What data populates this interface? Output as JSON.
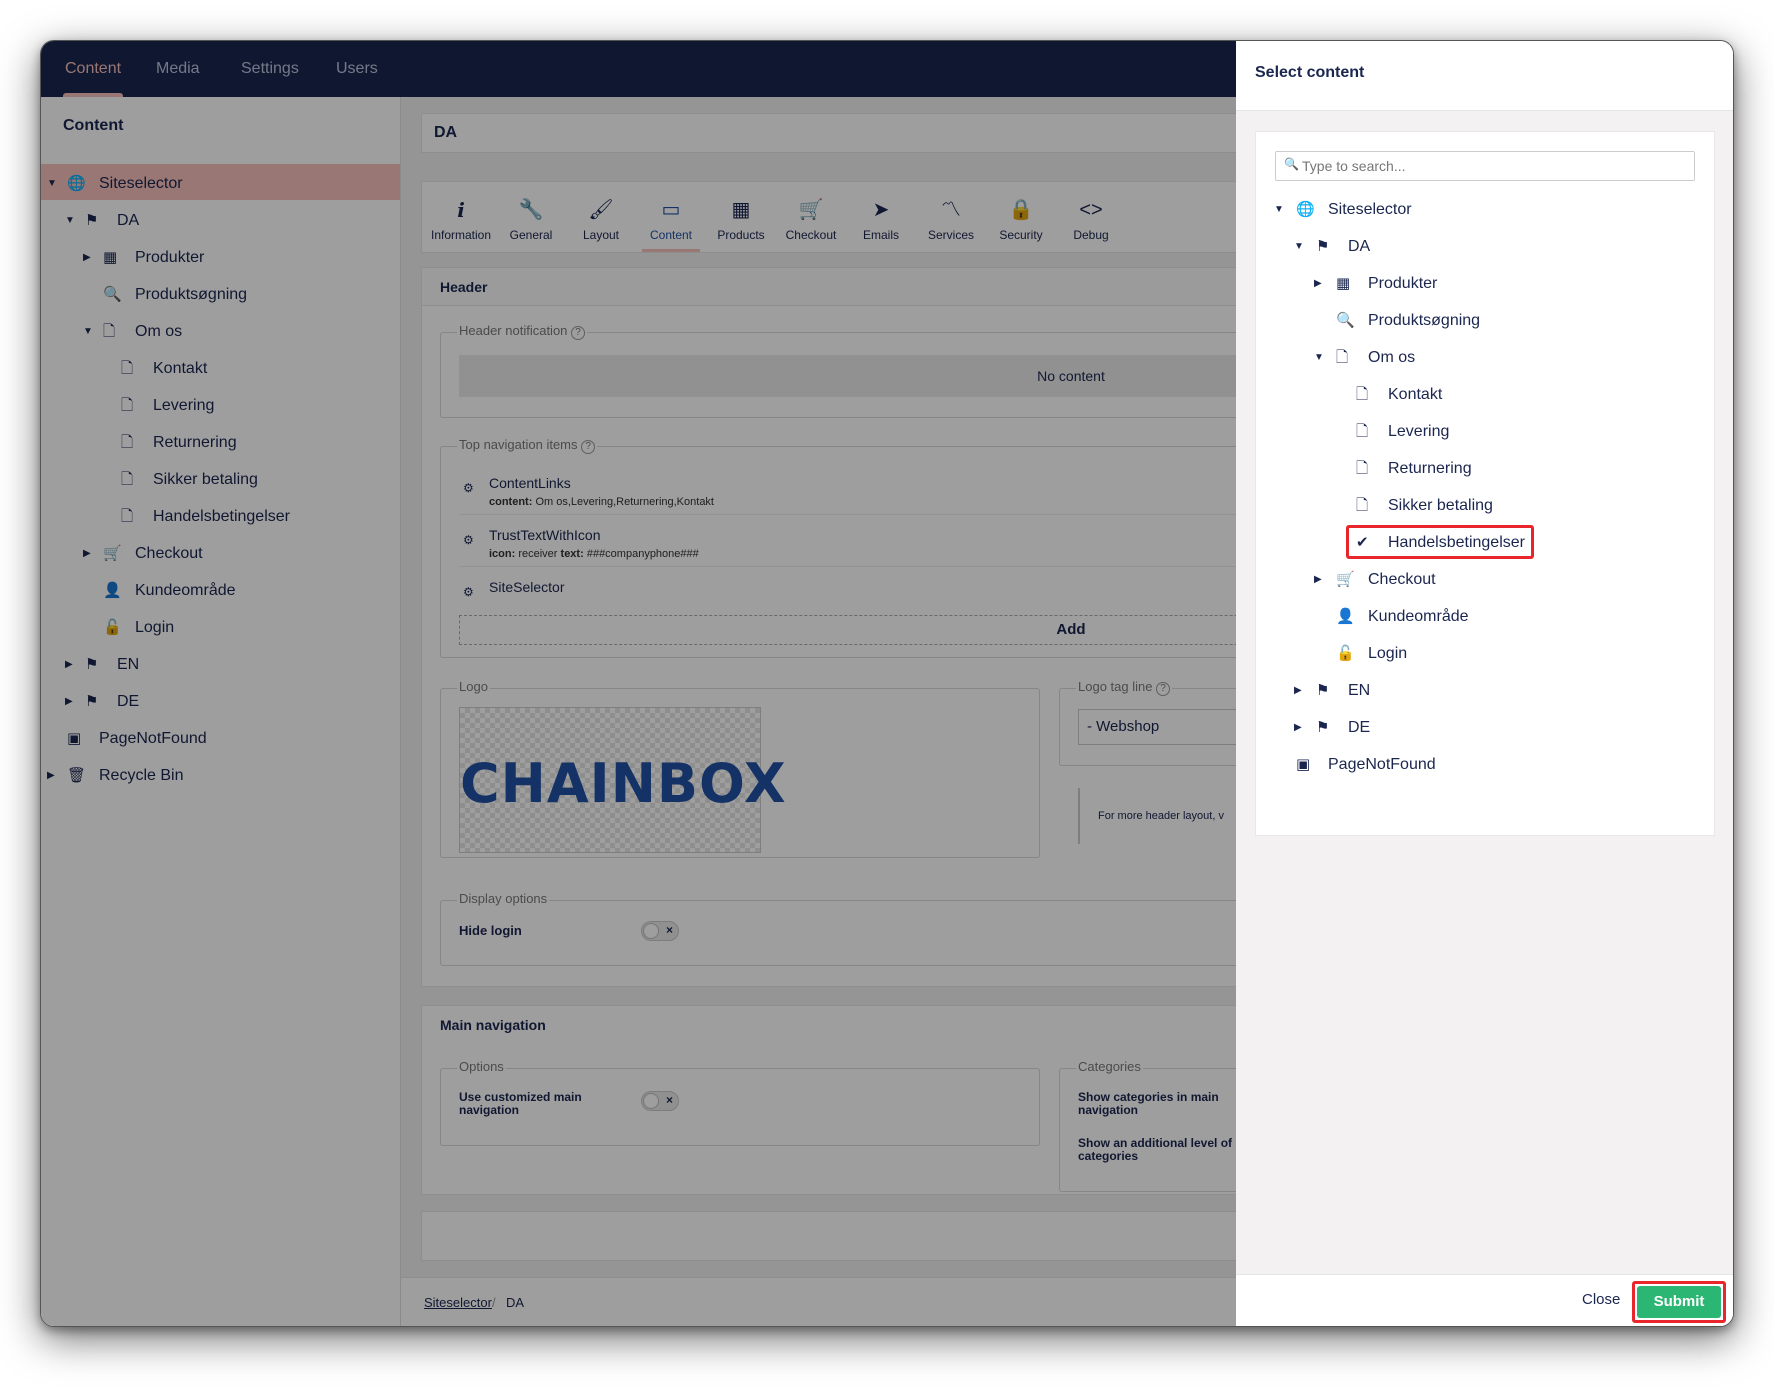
{
  "topnav": {
    "items": [
      "Content",
      "Media",
      "Settings",
      "Users"
    ]
  },
  "sidebar": {
    "title": "Content",
    "tree": [
      {
        "label": "Siteselector",
        "icon": "globe-icon"
      },
      {
        "label": "DA",
        "icon": "flag-icon"
      },
      {
        "label": "Produkter",
        "icon": "grid-icon"
      },
      {
        "label": "Produktsøgning",
        "icon": "search-icon"
      },
      {
        "label": "Om os",
        "icon": "page-icon"
      },
      {
        "label": "Kontakt",
        "icon": "page-icon"
      },
      {
        "label": "Levering",
        "icon": "page-icon"
      },
      {
        "label": "Returnering",
        "icon": "page-icon"
      },
      {
        "label": "Sikker betaling",
        "icon": "page-icon"
      },
      {
        "label": "Handelsbetingelser",
        "icon": "page-icon"
      },
      {
        "label": "Checkout",
        "icon": "cart-icon"
      },
      {
        "label": "Kundeområde",
        "icon": "user-icon"
      },
      {
        "label": "Login",
        "icon": "unlock-icon"
      },
      {
        "label": "EN",
        "icon": "flag-icon"
      },
      {
        "label": "DE",
        "icon": "flag-icon"
      },
      {
        "label": "PageNotFound",
        "icon": "notfound-icon"
      },
      {
        "label": "Recycle Bin",
        "icon": "trash-icon"
      }
    ]
  },
  "editor": {
    "name_value": "DA",
    "tabs": [
      "Information",
      "General",
      "Layout",
      "Content",
      "Products",
      "Checkout",
      "Emails",
      "Services",
      "Security",
      "Debug"
    ],
    "active_tab": "Content",
    "header_section": "Header",
    "header_notification_label": "Header notification",
    "no_content": "No content",
    "top_nav_label": "Top navigation items",
    "nav_items": [
      {
        "title": "ContentLinks",
        "key": "content:",
        "value": "Om os,Levering,Returnering,Kontakt"
      },
      {
        "title": "TrustTextWithIcon",
        "key": "icon:",
        "value": "receiver",
        "key2": "text:",
        "value2": "###companyphone###"
      },
      {
        "title": "SiteSelector"
      }
    ],
    "add_label": "Add",
    "logo_label": "Logo",
    "logo_text": "CHAINBOX",
    "logo_tag_label": "Logo tag line",
    "logo_tag_value": "- Webshop",
    "header_layout_hint": "For more header layout, v",
    "display_options_label": "Display options",
    "hide_login_label": "Hide login",
    "main_nav_section": "Main navigation",
    "options_label": "Options",
    "use_custom_nav_label": "Use customized main navigation",
    "categories_label": "Categories",
    "show_categories_label": "Show categories in main navigation",
    "show_additional_label": "Show an additional level of categories",
    "breadcrumb": [
      "Siteselector",
      "DA"
    ],
    "breadcrumb_sep": "/"
  },
  "dialog": {
    "title": "Select content",
    "search_placeholder": "Type to search...",
    "tree": [
      {
        "label": "Siteselector",
        "icon": "globe-icon"
      },
      {
        "label": "DA",
        "icon": "flag-icon"
      },
      {
        "label": "Produkter",
        "icon": "grid-icon"
      },
      {
        "label": "Produktsøgning",
        "icon": "search-icon"
      },
      {
        "label": "Om os",
        "icon": "page-icon"
      },
      {
        "label": "Kontakt",
        "icon": "page-icon"
      },
      {
        "label": "Levering",
        "icon": "page-icon"
      },
      {
        "label": "Returnering",
        "icon": "page-icon"
      },
      {
        "label": "Sikker betaling",
        "icon": "page-icon"
      },
      {
        "label": "Handelsbetingelser",
        "icon": "check-icon",
        "selected": true
      },
      {
        "label": "Checkout",
        "icon": "cart-icon"
      },
      {
        "label": "Kundeområde",
        "icon": "user-icon"
      },
      {
        "label": "Login",
        "icon": "unlock-icon"
      },
      {
        "label": "EN",
        "icon": "flag-icon"
      },
      {
        "label": "DE",
        "icon": "flag-icon"
      },
      {
        "label": "PageNotFound",
        "icon": "notfound-icon"
      }
    ],
    "close_label": "Close",
    "submit_label": "Submit"
  },
  "colors": {
    "topbar": "#1b264f",
    "accent": "#f5c1bc",
    "submit": "#2bb673",
    "highlight": "#e8262b",
    "selected_row": "#f5c1bc"
  }
}
